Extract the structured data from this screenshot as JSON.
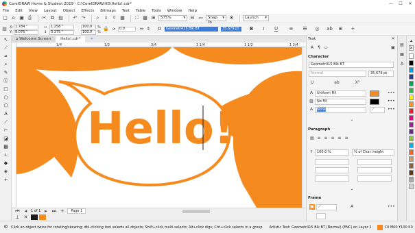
{
  "window": {
    "title": "CorelDRAW Home & Student 2019 - C:\\CorelDRAW.HD\\Hello!.cdr*",
    "minimize": "—",
    "maximize": "☐",
    "close": "✕"
  },
  "menu": [
    "File",
    "Edit",
    "View",
    "Layout",
    "Object",
    "Effects",
    "Bitmaps",
    "Text",
    "Table",
    "Tools",
    "Window",
    "Help"
  ],
  "toolbar": {
    "zoom": "575%",
    "snap_to": "Snap To",
    "launch": "Launch"
  },
  "propbar": {
    "x": "1.784 \"",
    "y": "9.076 \"",
    "width": "1.258 \"",
    "height": "0.375 \"",
    "scale_w": "100.0",
    "scale_h": "100.0",
    "scale_unit": "%",
    "angle": "0.0",
    "font": "Geometr415 Blk BT",
    "size": "35.679 pt"
  },
  "tabs": {
    "welcome": "Welcome Screen",
    "doc": "Hello!.cdr*",
    "add": "+"
  },
  "ruler_ticks": [
    "1/4",
    "1/2",
    "3/4",
    "1 1/4",
    "1 1/2",
    "1 3/4"
  ],
  "canvas": {
    "text": "Hello!",
    "accent": "#f58a1f"
  },
  "page_nav": {
    "counter": "1 of 1",
    "page_tab": "Page 1"
  },
  "status": {
    "hint": "Click an object twice for rotating/skewing; dbl-clicking tool selects all objects; Shift+click multi-selects; Alt+click digs; Ctrl+click selects in a group",
    "object_info": "Artistic Text: Geometr415 Blk BT (Normal) (ENC) on Layer 2",
    "fill_color": "C0 M60 Y100 K0"
  },
  "docker": {
    "panel_title": "Text",
    "character_section": "Character",
    "font_name": "Geometr415 Blk BT",
    "font_style": "Normal",
    "font_size": "35.679 pt",
    "fill_type": "Uniform Fill",
    "bg_fill": "No Fill",
    "outline": "None",
    "paragraph_section": "Paragraph",
    "line_spacing": "100.0 %",
    "spacing_unit": "% of Char. height",
    "frame_section": "Frame"
  },
  "colors": {
    "orange": "#f58a1f",
    "selection": "#3b7ddd",
    "palette": [
      "#ffffff",
      "#000000",
      "#00a0e9",
      "#2b3990",
      "#00a651",
      "#39b54a",
      "#fff200",
      "#f7941d",
      "#ed1c24",
      "#ec008c",
      "#92278f",
      "#662d91",
      "#8dc63f",
      "#00aeef",
      "#f26522",
      "#c69c6d",
      "#8c6239",
      "#603913",
      "#a7a9ac",
      "#d1d3d4"
    ]
  }
}
